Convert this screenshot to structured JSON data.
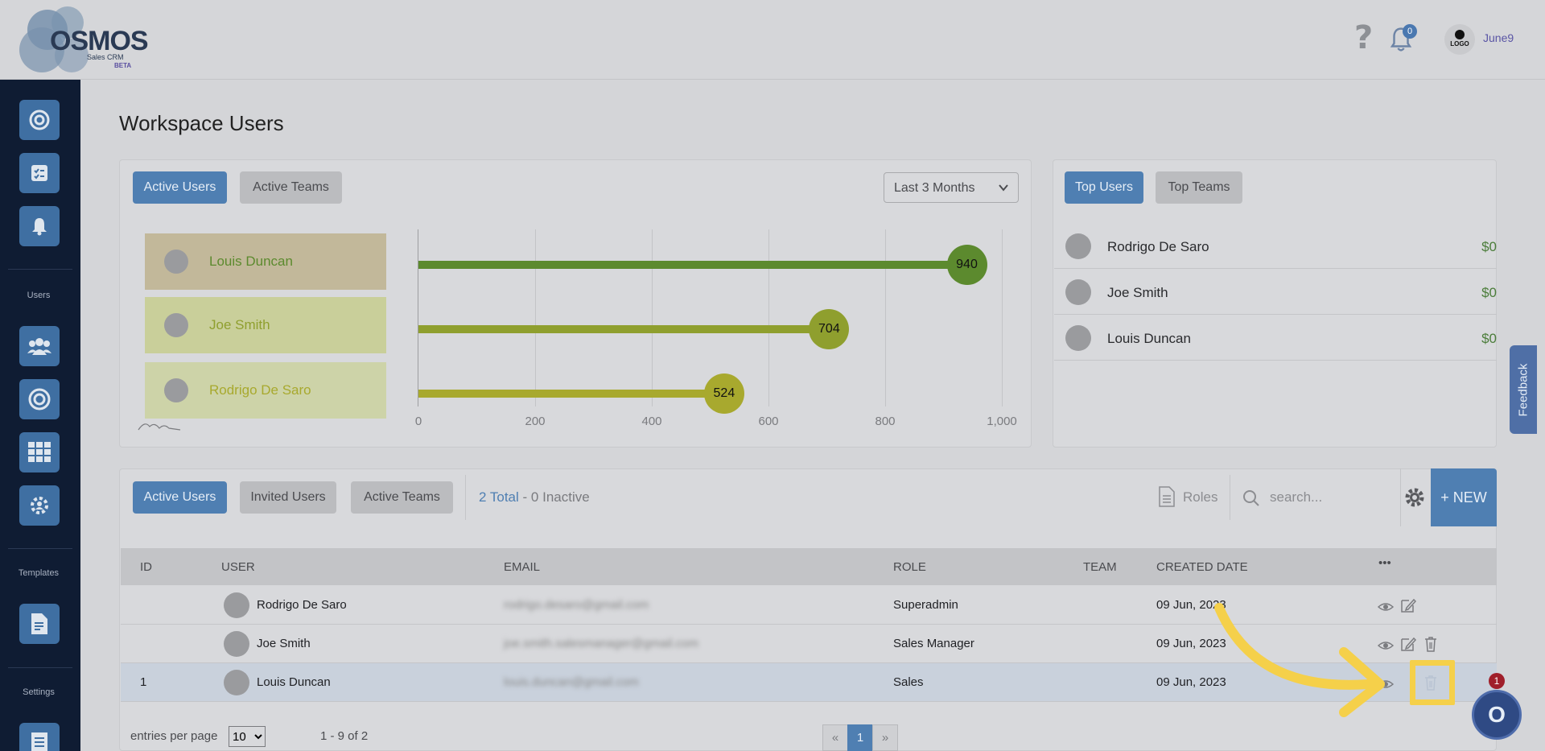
{
  "header": {
    "brand": "OSMOS",
    "brand_sub": "Sales CRM",
    "brand_beta": "BETA",
    "help_icon": "?",
    "notification_count": "0",
    "workspace_logo": "LOGO",
    "username": "June9"
  },
  "sidebar": {
    "section_users": "Users",
    "section_templates": "Templates",
    "section_settings": "Settings",
    "icons": [
      "target-icon",
      "checklist-icon",
      "reminder-bell-icon",
      "users-group-icon",
      "goal-icon",
      "grid-icon",
      "team-gear-icon",
      "template-doc-icon",
      "settings-doc-icon"
    ]
  },
  "page": {
    "title": "Workspace Users"
  },
  "chart_panel": {
    "tab_active_users": "Active Users",
    "tab_active_teams": "Active Teams",
    "period": "Last 3 Months",
    "rows": [
      {
        "name": "Louis Duncan",
        "color": "#c2b89a",
        "bar_color": "#5c8a2e"
      },
      {
        "name": "Joe Smith",
        "color": "#c9cf9a",
        "bar_color": "#8f9f2e"
      },
      {
        "name": "Rodrigo De Saro",
        "color": "#cdd3a8",
        "bar_color": "#a8a92e"
      }
    ],
    "ticks": [
      "0",
      "200",
      "400",
      "600",
      "800",
      "1,000"
    ]
  },
  "chart_data": {
    "type": "bar",
    "orientation": "horizontal",
    "categories": [
      "Louis Duncan",
      "Joe Smith",
      "Rodrigo De Saro"
    ],
    "values": [
      940,
      704,
      524
    ],
    "xlim": [
      0,
      1000
    ],
    "grid": true
  },
  "top_panel": {
    "tab_top_users": "Top Users",
    "tab_top_teams": "Top Teams",
    "users": [
      {
        "name": "Rodrigo De Saro",
        "amount": "$0"
      },
      {
        "name": "Joe Smith",
        "amount": "$0"
      },
      {
        "name": "Louis Duncan",
        "amount": "$0"
      }
    ]
  },
  "feedback_label": "Feedback",
  "table_panel": {
    "tab_active_users": "Active Users",
    "tab_invited_users": "Invited Users",
    "tab_active_teams": "Active Teams",
    "total": "2 Total",
    "separator": "-",
    "inactive": "0 Inactive",
    "roles_label": "Roles",
    "search_placeholder": "search...",
    "new_label": "+ NEW",
    "columns": [
      "ID",
      "USER",
      "EMAIL",
      "ROLE",
      "TEAM",
      "CREATED DATE",
      "•••"
    ],
    "rows": [
      {
        "id": "",
        "user": "Rodrigo De Saro",
        "email": "rodrigo.desaro@gmail.com",
        "role": "Superadmin",
        "team": "",
        "created": "09 Jun, 2023"
      },
      {
        "id": "",
        "user": "Joe Smith",
        "email": "joe.smith.salesmanager@gmail.com",
        "role": "Sales Manager",
        "team": "",
        "created": "09 Jun, 2023"
      },
      {
        "id": "1",
        "user": "Louis Duncan",
        "email": "louis.duncan@gmail.com",
        "role": "Sales",
        "team": "",
        "created": "09 Jun, 2023"
      }
    ],
    "entries_label": "entries per page",
    "entries_value": "10",
    "range_label": "1 - 9 of 2",
    "pager": {
      "prev": "«",
      "current": "1",
      "next": "»"
    }
  },
  "chat": {
    "badge": "1",
    "icon_letter": "O"
  }
}
